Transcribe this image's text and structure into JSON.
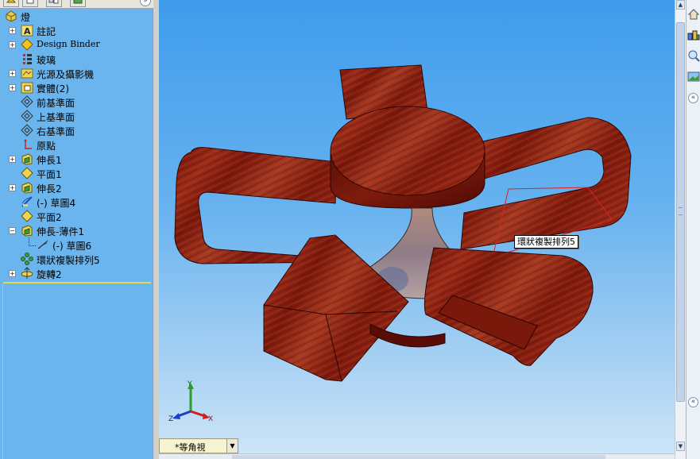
{
  "tree": {
    "root_label": "燈",
    "items": [
      {
        "label": "註記",
        "icon": "annotations-icon",
        "expandable": true
      },
      {
        "label": "Design Binder",
        "icon": "design-binder-icon",
        "expandable": true
      },
      {
        "label": "玻璃",
        "icon": "material-icon",
        "expandable": false
      },
      {
        "label": "光源及攝影機",
        "icon": "lights-cameras-icon",
        "expandable": true
      },
      {
        "label": "實體(2)",
        "icon": "solid-bodies-icon",
        "expandable": true
      },
      {
        "label": "前基準面",
        "icon": "plane-icon",
        "expandable": false
      },
      {
        "label": "上基準面",
        "icon": "plane-icon",
        "expandable": false
      },
      {
        "label": "右基準面",
        "icon": "plane-icon",
        "expandable": false
      },
      {
        "label": "原點",
        "icon": "origin-icon",
        "expandable": false
      },
      {
        "label": "伸長1",
        "icon": "extrude-icon",
        "expandable": true
      },
      {
        "label": "平面1",
        "icon": "plane-icon",
        "expandable": false
      },
      {
        "label": "伸長2",
        "icon": "extrude-icon",
        "expandable": true
      },
      {
        "label": "(-) 草圖4",
        "icon": "sketch-icon",
        "expandable": false
      },
      {
        "label": "平面2",
        "icon": "plane-icon",
        "expandable": false
      },
      {
        "label": "伸長-薄件1",
        "icon": "extrude-icon",
        "expandable": true,
        "expanded": true
      },
      {
        "label": "(-) 草圖6",
        "icon": "sketch-icon",
        "expandable": false,
        "child": true
      },
      {
        "label": "環狀複製排列5",
        "icon": "circular-pattern-icon",
        "expandable": false
      },
      {
        "label": "旋轉2",
        "icon": "revolve-icon",
        "expandable": true
      }
    ]
  },
  "viewport": {
    "callout_label": "環狀複製排列5",
    "view_orientation": "*等角視",
    "triad": {
      "x": "X",
      "y": "Y",
      "z": "Z"
    }
  },
  "colors": {
    "tree_bg": "#6ab5ee",
    "wood": "#8e1f12",
    "highlight": "#e8d64a"
  }
}
